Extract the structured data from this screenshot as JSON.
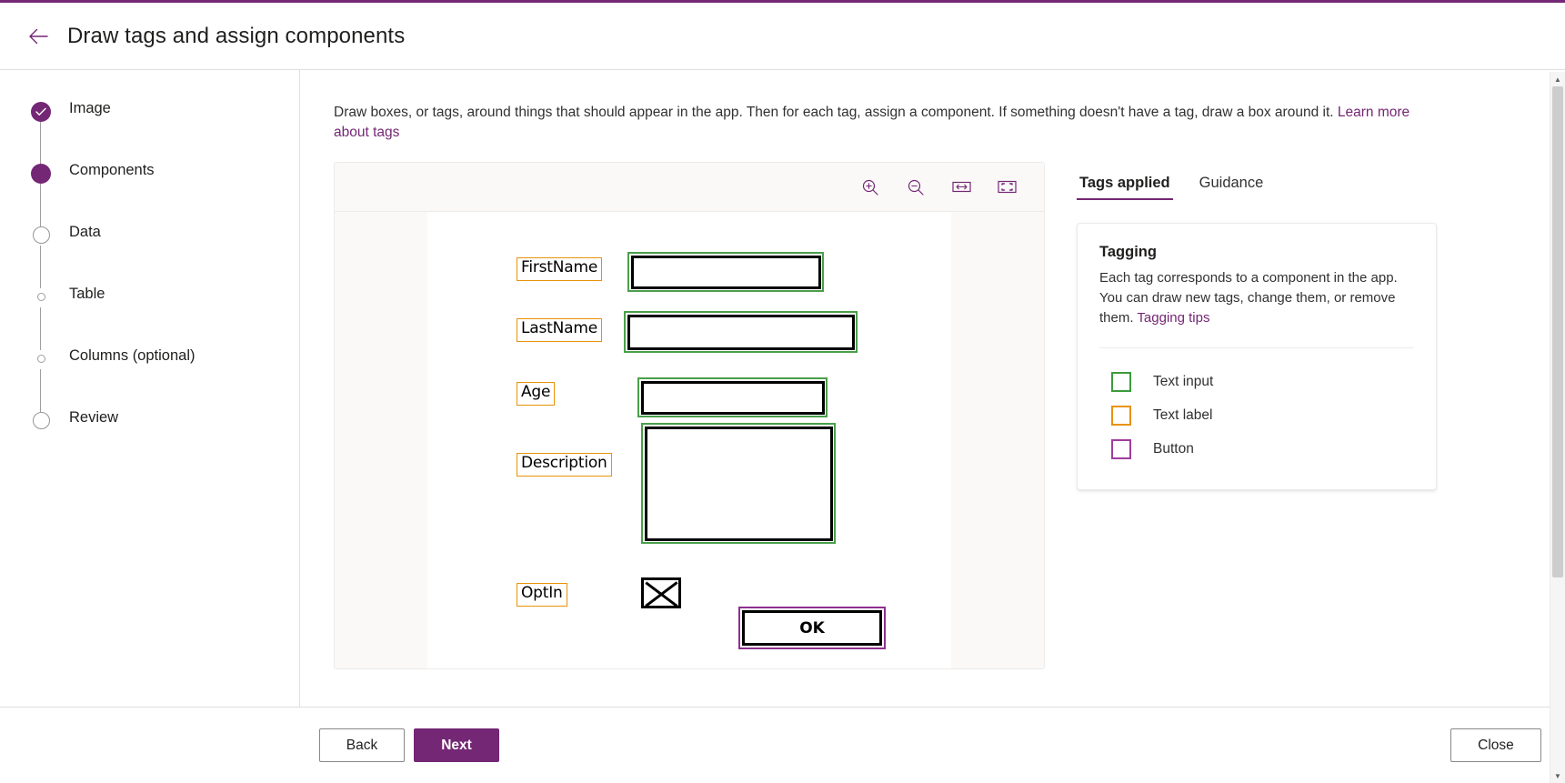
{
  "header": {
    "title": "Draw tags and assign components",
    "back_icon": "back-arrow-icon"
  },
  "sidebar": {
    "steps": [
      {
        "label": "Image",
        "state": "done"
      },
      {
        "label": "Components",
        "state": "current"
      },
      {
        "label": "Data",
        "state": "next"
      },
      {
        "label": "Table",
        "state": "upcoming"
      },
      {
        "label": "Columns (optional)",
        "state": "upcoming"
      },
      {
        "label": "Review",
        "state": "next"
      }
    ]
  },
  "main": {
    "intro_text": "Draw boxes, or tags, around things that should appear in the app. Then for each tag, assign a component. If something doesn't have a tag, draw a box around it. ",
    "intro_link": "Learn more about tags"
  },
  "canvas": {
    "toolbar": [
      {
        "name": "zoom-in-icon",
        "label": "Zoom in"
      },
      {
        "name": "zoom-out-icon",
        "label": "Zoom out"
      },
      {
        "name": "fit-width-icon",
        "label": "Fit to width"
      },
      {
        "name": "fit-page-icon",
        "label": "Fit to page"
      }
    ],
    "sketch": {
      "fields": [
        {
          "label": "FirstName",
          "component": "Text input"
        },
        {
          "label": "LastName",
          "component": "Text input"
        },
        {
          "label": "Age",
          "component": "Text input"
        },
        {
          "label": "Description",
          "component": "Text input"
        },
        {
          "label": "OptIn",
          "component": "Checkbox"
        }
      ],
      "button_label": "OK"
    }
  },
  "right_panel": {
    "tabs": [
      {
        "label": "Tags applied",
        "active": true
      },
      {
        "label": "Guidance",
        "active": false
      }
    ],
    "card": {
      "title": "Tagging",
      "text": "Each tag corresponds to a component in the app. You can draw new tags, change them, or remove them. ",
      "link": "Tagging tips",
      "legend": [
        {
          "label": "Text input",
          "color": "#3b9c3b"
        },
        {
          "label": "Text label",
          "color": "#e8920a"
        },
        {
          "label": "Button",
          "color": "#a03ca0"
        }
      ]
    }
  },
  "footer": {
    "back_label": "Back",
    "next_label": "Next",
    "close_label": "Close"
  },
  "colors": {
    "accent": "#742774",
    "text_input": "#3b9c3b",
    "text_label": "#e8920a",
    "button": "#a03ca0"
  }
}
